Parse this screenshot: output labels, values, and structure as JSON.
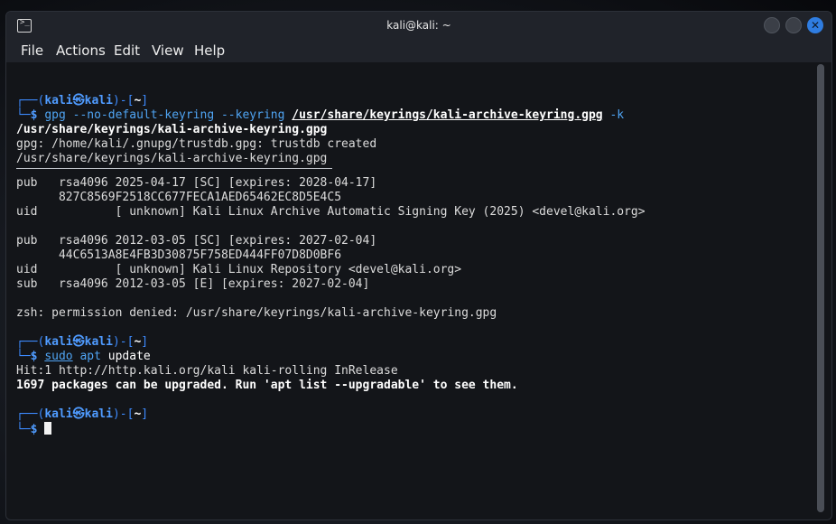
{
  "window": {
    "title": "kali@kali: ~",
    "close_glyph": "✕"
  },
  "menu": [
    "File",
    "Actions",
    "Edit",
    "View",
    "Help"
  ],
  "prompt": {
    "top_left": "┌──(",
    "user": "kali",
    "at_glyph": "㉿",
    "host": "kali",
    "mid": ")-[",
    "dir": "~",
    "end": "]",
    "bottom_left": "└─",
    "symbol": "$"
  },
  "blocks": {
    "cmd1": {
      "cmd": "gpg",
      "opts": "--no-default-keyring --keyring",
      "path": "/usr/share/keyrings/kali-archive-keyring.gpg",
      "flag": "-k"
    },
    "out1": [
      "/usr/share/keyrings/kali-archive-keyring.gpg",
      "gpg: /home/kali/.gnupg/trustdb.gpg: trustdb created",
      "/usr/share/keyrings/kali-archive-keyring.gpg"
    ],
    "keys": [
      "pub   rsa4096 2025-04-17 [SC] [expires: 2028-04-17]",
      "      827C8569F2518CC677FECA1AED65462EC8D5E4C5",
      "uid           [ unknown] Kali Linux Archive Automatic Signing Key (2025) <devel@kali.org>",
      "",
      "pub   rsa4096 2012-03-05 [SC] [expires: 2027-02-04]",
      "      44C6513A8E4FB3D30875F758ED444FF07D8D0BF6",
      "uid           [ unknown] Kali Linux Repository <devel@kali.org>",
      "sub   rsa4096 2012-03-05 [E] [expires: 2027-02-04]"
    ],
    "err": "zsh: permission denied: /usr/share/keyrings/kali-archive-keyring.gpg",
    "cmd2": {
      "sudo": "sudo",
      "apt": "apt",
      "arg": "update"
    },
    "out2": [
      "Hit:1 http://http.kali.org/kali kali-rolling InRelease",
      "1697 packages can be upgraded. Run 'apt list --upgradable' to see them."
    ]
  },
  "colors": {
    "prompt_blue": "#3d8bff",
    "command_blue": "#4fa4f3",
    "terminal_bg": "#121419",
    "close_button": "#2f7de1"
  }
}
